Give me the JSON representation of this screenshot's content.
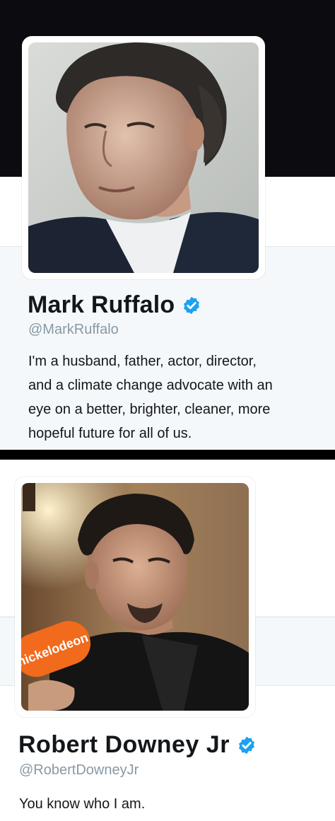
{
  "profiles": [
    {
      "name": "Mark Ruffalo",
      "handle": "@MarkRuffalo",
      "bio_lines": [
        "I'm a husband, father, actor, director,",
        "and a climate change advocate with an",
        "eye on a better, brighter, cleaner, more",
        "hopeful future for all of us."
      ],
      "verified": true,
      "avatar_icon": "profile-photo"
    },
    {
      "name": "Robert Downey Jr",
      "handle": "@RobertDowneyJr",
      "bio_lines": [
        "You know who I am."
      ],
      "verified": true,
      "avatar_icon": "profile-photo",
      "microphone_logo_text": "nickelodeon"
    }
  ],
  "colors": {
    "verified_badge": "#1da1f2",
    "name_text": "#14171a",
    "handle_text": "#8899a6",
    "header_dark": "#0b0b10",
    "panel_background": "#f5f8fa",
    "divider": "#000000"
  }
}
